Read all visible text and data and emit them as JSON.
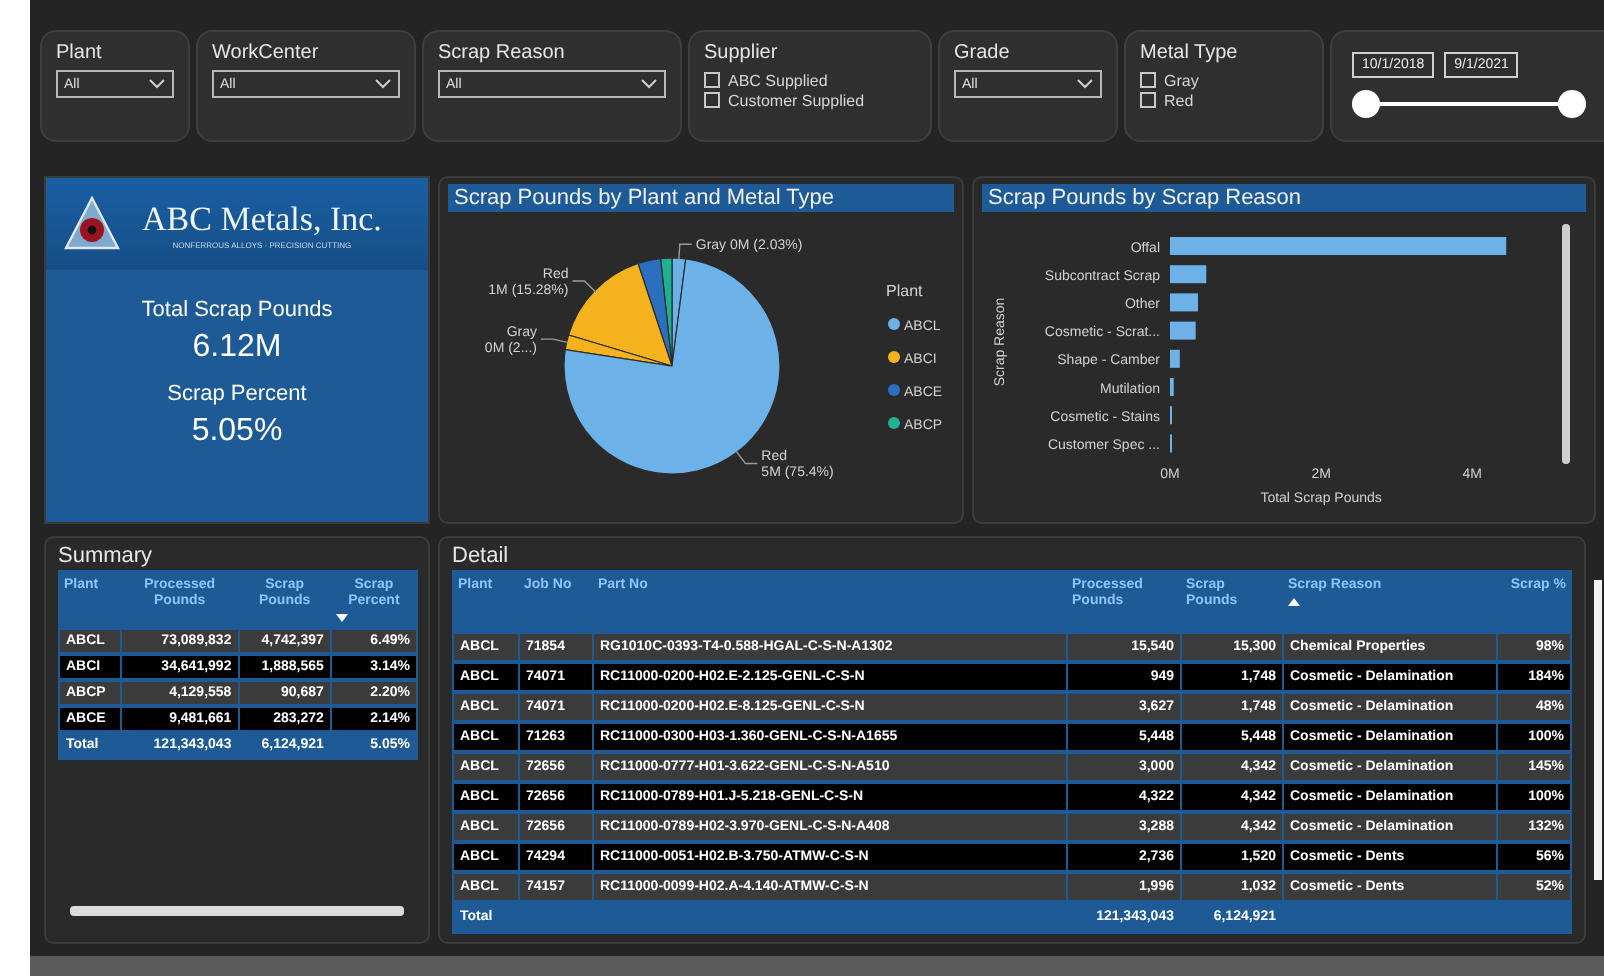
{
  "filters": [
    {
      "kind": "dropdown",
      "label": "Plant",
      "value": "All"
    },
    {
      "kind": "dropdown",
      "label": "WorkCenter",
      "value": "All"
    },
    {
      "kind": "dropdown",
      "label": "Scrap Reason",
      "value": "All"
    },
    {
      "kind": "checklist",
      "label": "Supplier",
      "options": [
        {
          "label": "ABC Supplied",
          "checked": false
        },
        {
          "label": "Customer Supplied",
          "checked": false
        }
      ]
    },
    {
      "kind": "dropdown",
      "label": "Grade",
      "value": "All"
    },
    {
      "kind": "checklist",
      "label": "Metal Type",
      "options": [
        {
          "label": "Gray",
          "checked": false
        },
        {
          "label": "Red",
          "checked": false
        }
      ]
    },
    {
      "kind": "daterange",
      "start": "10/1/2018",
      "end": "9/1/2021",
      "handles": [
        {
          "level": 0
        },
        {
          "level": 1
        }
      ]
    }
  ],
  "brand": {
    "name": "ABC Metals, Inc.",
    "tagline": "NONFERROUS ALLOYS · PRECISION CUTTING"
  },
  "kpis": [
    {
      "label": "Total Scrap Pounds",
      "value": "6.12M"
    },
    {
      "label": "Scrap Percent",
      "value": "5.05%"
    }
  ],
  "pie_panel": {
    "chart_data": {
      "type": "pie",
      "title": "Scrap Pounds by Plant and Metal Type",
      "values": [
        2.03,
        1.69,
        3.4,
        15.28,
        2.2,
        75.4
      ]
    },
    "slices": [
      {
        "color": "#6cb2e8",
        "label": {
          "kind": "inline",
          "name": "Gray",
          "value": "0M (2.03%)"
        }
      },
      {
        "color": "#1fb28f"
      },
      {
        "color": "#2a6fc0"
      },
      {
        "color": "#f4b21c",
        "label": {
          "kind": "stacked",
          "name": "Red",
          "value": "1M (15.28%)"
        }
      },
      {
        "color": "#f4b21c",
        "label": {
          "kind": "stacked",
          "name": "Gray",
          "value": "0M (2...)"
        }
      },
      {
        "color": "#6cb2e8",
        "label": {
          "kind": "stacked",
          "name": "Red",
          "value": "5M (75.4%)"
        }
      }
    ],
    "legend": {
      "title": "Plant",
      "items": [
        {
          "name": "ABCL",
          "color": "#6cb2e8"
        },
        {
          "name": "ABCI",
          "color": "#f4b21c"
        },
        {
          "name": "ABCE",
          "color": "#2a6fc0"
        },
        {
          "name": "ABCP",
          "color": "#1fb28f"
        }
      ]
    }
  },
  "bar_panel": {
    "chart_data": {
      "type": "bar",
      "orientation": "horizontal",
      "title": "Scrap Pounds by Scrap Reason",
      "xlabel": "Total Scrap Pounds",
      "ylabel": "Scrap Reason",
      "categories": [
        "Offal",
        "Subcontract Scrap",
        "Other",
        "Cosmetic - Scrat...",
        "Shape - Camber",
        "Mutilation",
        "Cosmetic - Stains",
        "Customer Spec ..."
      ],
      "values": [
        4.45,
        0.48,
        0.37,
        0.34,
        0.13,
        0.05,
        0.02,
        0.02
      ],
      "xlim": [
        0,
        4.5
      ],
      "xticks": [
        {
          "value": 0,
          "label": "0M"
        },
        {
          "value": 2,
          "label": "2M"
        },
        {
          "value": 4,
          "label": "4M"
        }
      ]
    }
  },
  "summary": {
    "title": "Summary",
    "columns": [
      {
        "label": "Plant",
        "sorted": false
      },
      {
        "label": "Processed Pounds",
        "sorted": false
      },
      {
        "label": "Scrap Pounds",
        "sorted": false
      },
      {
        "label": "Scrap Percent",
        "sorted": true,
        "ascending": false
      }
    ],
    "rows": [
      [
        "ABCL",
        "73,089,832",
        "4,742,397",
        "6.49%"
      ],
      [
        "ABCI",
        "34,641,992",
        "1,888,565",
        "3.14%"
      ],
      [
        "ABCP",
        "4,129,558",
        "90,687",
        "2.20%"
      ],
      [
        "ABCE",
        "9,481,661",
        "283,272",
        "2.14%"
      ]
    ],
    "total": [
      "Total",
      "121,343,043",
      "6,124,921",
      "5.05%"
    ]
  },
  "detail": {
    "title": "Detail",
    "columns": [
      {
        "label": "Plant",
        "sorted": false
      },
      {
        "label": "Job No",
        "sorted": false
      },
      {
        "label": "Part No",
        "sorted": false
      },
      {
        "label": "Processed Pounds",
        "sorted": false
      },
      {
        "label": "Scrap Pounds",
        "sorted": false
      },
      {
        "label": "Scrap Reason",
        "sorted": true,
        "ascending": true
      },
      {
        "label": "Scrap %",
        "sorted": false
      }
    ],
    "rows": [
      [
        "ABCL",
        "71854",
        "RG1010C-0393-T4-0.588-HGAL-C-S-N-A1302",
        "15,540",
        "15,300",
        "Chemical Properties",
        "98%"
      ],
      [
        "ABCL",
        "74071",
        "RC11000-0200-H02.E-2.125-GENL-C-S-N",
        "949",
        "1,748",
        "Cosmetic - Delamination",
        "184%"
      ],
      [
        "ABCL",
        "74071",
        "RC11000-0200-H02.E-8.125-GENL-C-S-N",
        "3,627",
        "1,748",
        "Cosmetic - Delamination",
        "48%"
      ],
      [
        "ABCL",
        "71263",
        "RC11000-0300-H03-1.360-GENL-C-S-N-A1655",
        "5,448",
        "5,448",
        "Cosmetic - Delamination",
        "100%"
      ],
      [
        "ABCL",
        "72656",
        "RC11000-0777-H01-3.622-GENL-C-S-N-A510",
        "3,000",
        "4,342",
        "Cosmetic - Delamination",
        "145%"
      ],
      [
        "ABCL",
        "72656",
        "RC11000-0789-H01.J-5.218-GENL-C-S-N",
        "4,322",
        "4,342",
        "Cosmetic - Delamination",
        "100%"
      ],
      [
        "ABCL",
        "72656",
        "RC11000-0789-H02-3.970-GENL-C-S-N-A408",
        "3,288",
        "4,342",
        "Cosmetic - Delamination",
        "132%"
      ],
      [
        "ABCL",
        "74294",
        "RC11000-0051-H02.B-3.750-ATMW-C-S-N",
        "2,736",
        "1,520",
        "Cosmetic - Dents",
        "56%"
      ],
      [
        "ABCL",
        "74157",
        "RC11000-0099-H02.A-4.140-ATMW-C-S-N",
        "1,996",
        "1,032",
        "Cosmetic - Dents",
        "52%"
      ]
    ],
    "total": {
      "label": "Total",
      "processed": "121,343,043",
      "scrap": "6,124,921"
    }
  }
}
